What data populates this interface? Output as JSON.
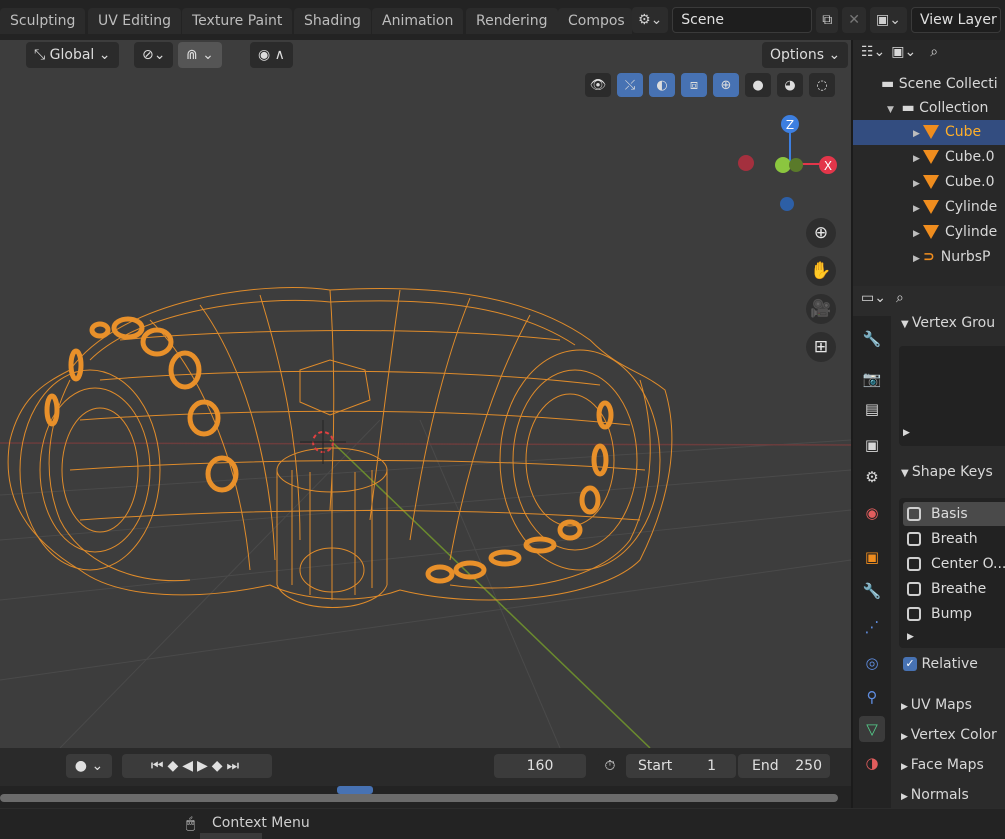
{
  "workspace_tabs": [
    "Sculpting",
    "UV Editing",
    "Texture Paint",
    "Shading",
    "Animation",
    "Rendering",
    "Compos"
  ],
  "scene": {
    "name": "Scene",
    "view_layer": "View Layer"
  },
  "viewport_header": {
    "orientation": "Global",
    "options": "Options"
  },
  "gizmo": {
    "z": "Z",
    "x": "X"
  },
  "timeline": {
    "current_frame": "160",
    "start_label": "Start",
    "start": "1",
    "end_label": "End",
    "end": "250"
  },
  "status": {
    "context_menu": "Context Menu"
  },
  "outliner": {
    "scene_collection": "Scene Collecti",
    "collection": "Collection",
    "items": [
      "Cube",
      "Cube.0",
      "Cube.0",
      "Cylinde",
      "Cylinde",
      "NurbsP"
    ]
  },
  "properties": {
    "vertex_groups": "Vertex Grou",
    "shape_keys": "Shape Keys",
    "keys": [
      "Basis",
      "Breath",
      "Center O...",
      "Breathe",
      "Bump"
    ],
    "relative": "Relative",
    "uv_maps": "UV Maps",
    "vertex_colors": "Vertex Color",
    "face_maps": "Face Maps",
    "normals": "Normals"
  },
  "colors": {
    "selection_orange": "#f08d1e",
    "active_blue": "#4772b3",
    "x_axis": "#e3364a",
    "y_axis": "#8bc63f",
    "z_axis": "#3d7fe0"
  }
}
